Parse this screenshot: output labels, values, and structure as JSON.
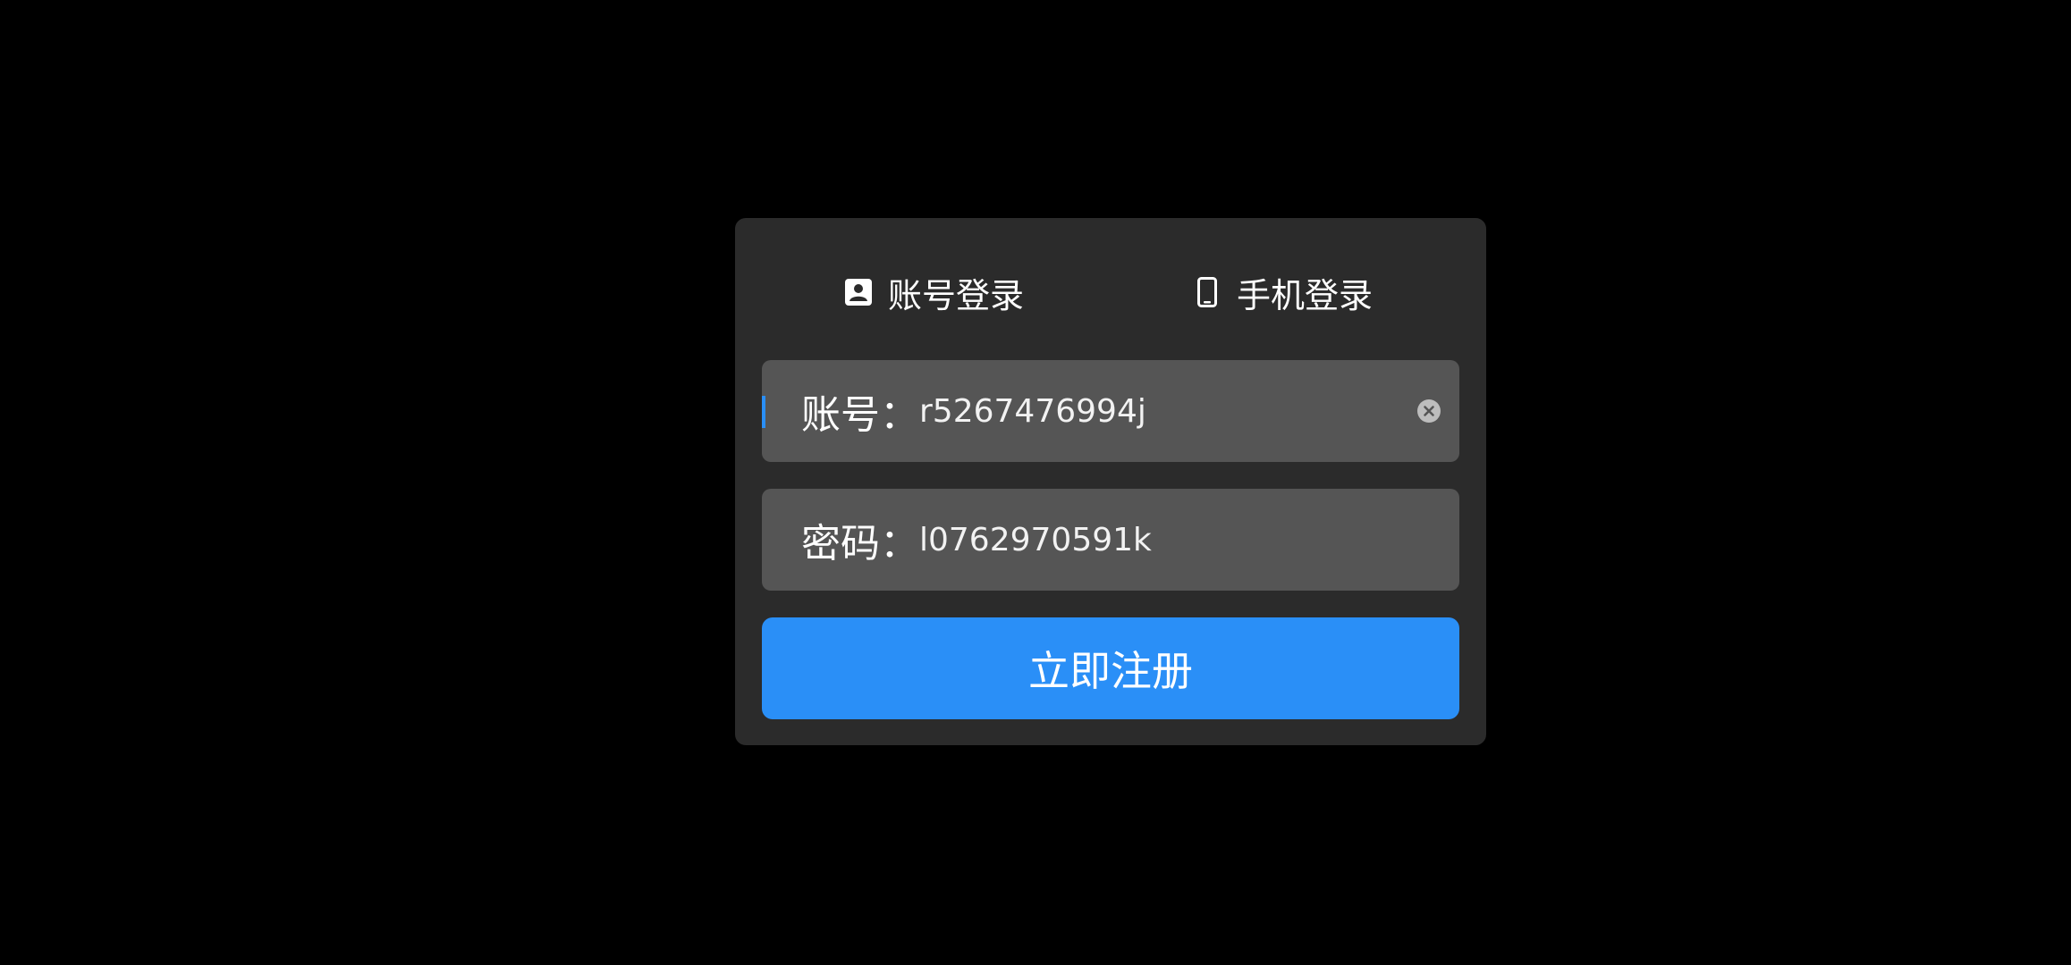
{
  "tabs": {
    "account": {
      "label": "账号登录",
      "icon": "account-box-icon"
    },
    "phone": {
      "label": "手机登录",
      "icon": "phone-icon"
    }
  },
  "form": {
    "account": {
      "label": "账号：",
      "value": "r5267476994j",
      "clear_icon": "clear-icon"
    },
    "password": {
      "label": "密码：",
      "value": "l0762970591k"
    },
    "submit_label": "立即注册"
  },
  "colors": {
    "background": "#000000",
    "dialog": "#2b2b2b",
    "field": "#555555",
    "accent": "#2a8ff7",
    "text": "#ffffff"
  }
}
